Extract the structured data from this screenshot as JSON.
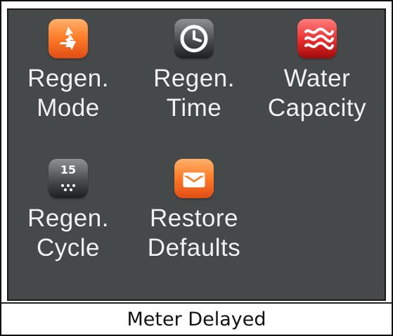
{
  "title": "Meter Delayed",
  "menu": [
    {
      "label_line1": "Regen.",
      "label_line2": "Mode",
      "icon": "recycle-icon",
      "color": "#ff7f2a"
    },
    {
      "label_line1": "Regen.",
      "label_line2": "Time",
      "icon": "clock-icon",
      "color": "#494b4c"
    },
    {
      "label_line1": "Water",
      "label_line2": "Capacity",
      "icon": "water-waves-icon",
      "color": "#e92b2b"
    },
    {
      "label_line1": "Regen.",
      "label_line2": "Cycle",
      "icon": "calendar-cycle-icon",
      "icon_text": "15",
      "color": "#494b4c"
    },
    {
      "label_line1": "Restore",
      "label_line2": "Defaults",
      "icon": "envelope-reset-icon",
      "color": "#ff7f2a"
    }
  ],
  "colors": {
    "screen_bg": "#46494a",
    "label_text": "#f2f2f2",
    "footer_text": "#111111"
  }
}
